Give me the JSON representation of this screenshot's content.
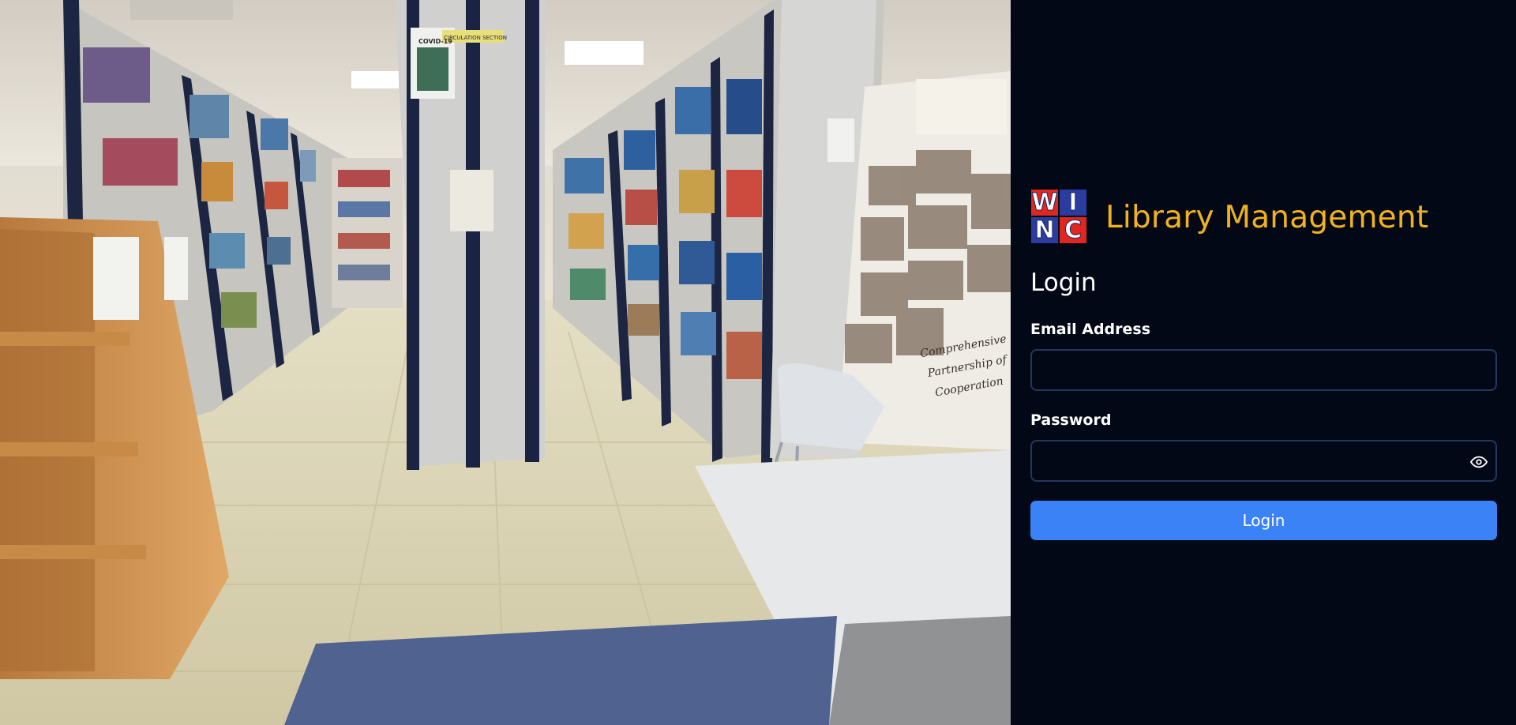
{
  "brand": {
    "logo_letters": [
      "W",
      "I",
      "N",
      "C"
    ],
    "logo_colors": [
      "#e0261d",
      "#2a3d9f",
      "#e0261d",
      "#2a3d9f"
    ],
    "title": "Library Management",
    "title_color": "#f2b21d"
  },
  "form": {
    "heading": "Login",
    "email_label": "Email Address",
    "email_value": "",
    "password_label": "Password",
    "password_value": "",
    "visibility_icon": "eye-icon",
    "submit_label": "Login",
    "submit_color": "#3b82f6"
  },
  "background_photo": {
    "subject": "library-interior",
    "sign_circulation": "CIRCULATION SECTION",
    "sign_covid": "COVID-19",
    "poster_lines": [
      "Comprehensive",
      "Partnership of",
      "Cooperation"
    ]
  }
}
